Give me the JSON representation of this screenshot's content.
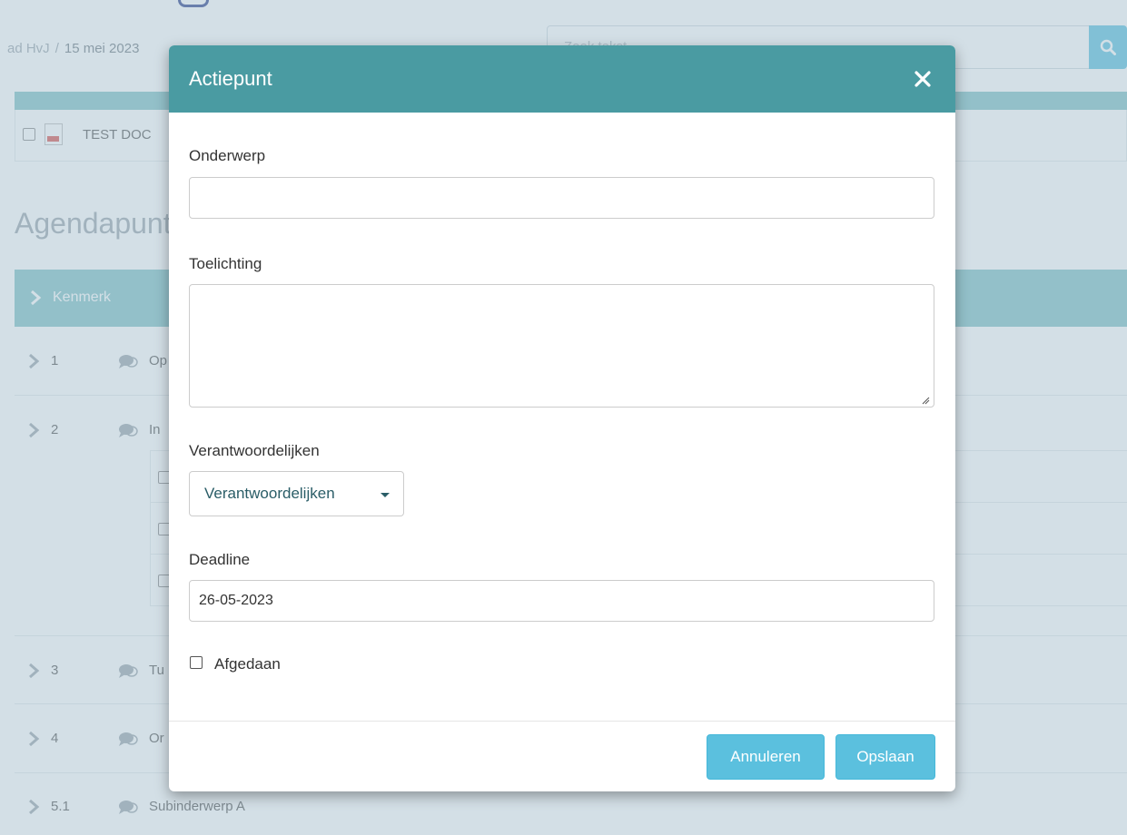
{
  "background": {
    "breadcrumb": {
      "parent": "ad HvJ",
      "separator": "/",
      "current": "15 mei 2023"
    },
    "search": {
      "placeholder": "Zoek tekst",
      "button_icon": "search-icon"
    },
    "documents": [
      {
        "name": "TEST DOC",
        "icon": "pdf-icon"
      }
    ],
    "section_title": "Agendapunten",
    "agenda_table": {
      "header": "Kenmerk",
      "rows": [
        {
          "number": "1",
          "title": "Op"
        },
        {
          "number": "2",
          "title": "In"
        },
        {
          "number": "3",
          "title": "Tu"
        },
        {
          "number": "4",
          "title": "Or"
        },
        {
          "number": "5.1",
          "title": "Subinderwerp A"
        }
      ]
    }
  },
  "modal": {
    "title": "Actiepunt",
    "close_icon": "close-icon",
    "fields": {
      "subject": {
        "label": "Onderwerp",
        "value": ""
      },
      "explanation": {
        "label": "Toelichting",
        "value": ""
      },
      "responsibles": {
        "label": "Verantwoordelijken",
        "dropdown_label": "Verantwoordelijken"
      },
      "deadline": {
        "label": "Deadline",
        "value": "26-05-2023"
      },
      "done": {
        "label": "Afgedaan",
        "checked": false
      }
    },
    "buttons": {
      "cancel": "Annuleren",
      "save": "Opslaan"
    }
  },
  "colors": {
    "modal_header": "#4a9ba2",
    "button_primary": "#5bc0de",
    "table_header": "#7fc0c4"
  }
}
